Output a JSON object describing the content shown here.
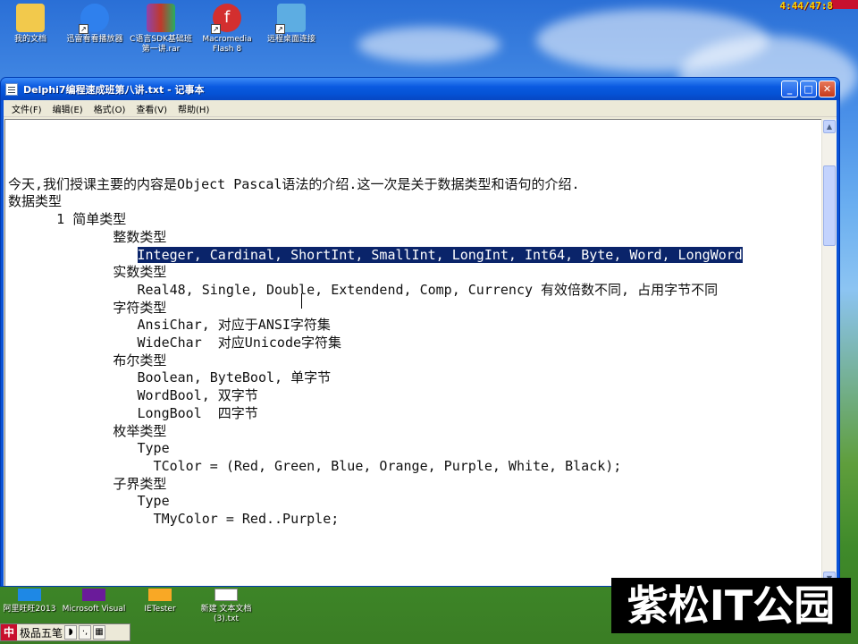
{
  "desktop": {
    "icons": [
      {
        "label": "我的文档",
        "icon": "folder-icon",
        "color": "#f2c94c"
      },
      {
        "label": "迅雷看看播放器",
        "icon": "xunlei-player-icon",
        "color": "#2f80ed"
      },
      {
        "label": "C语言SDK基础班第一讲.rar",
        "icon": "winrar-archive-icon",
        "color": "#8e44ad"
      },
      {
        "label": "Macromedia Flash 8",
        "icon": "flash-icon",
        "color": "#d32f2f"
      },
      {
        "label": "远程桌面连接",
        "icon": "remote-desktop-icon",
        "color": "#5dade2"
      }
    ],
    "bottom_icons": [
      {
        "label": "阿里旺旺2013",
        "icon": "aliwangwang-icon"
      },
      {
        "label": "Microsoft Visual",
        "icon": "visual-studio-icon"
      },
      {
        "label": "IETester",
        "icon": "ietester-icon"
      },
      {
        "label": "新建 文本文档 (3).txt",
        "icon": "text-file-icon"
      }
    ],
    "clock": "4:44/47:8"
  },
  "window": {
    "title": "Delphi7编程速成班第八讲.txt - 记事本",
    "buttons": {
      "minimize": "_",
      "maximize": "□",
      "close": "✕"
    },
    "menu": [
      "文件(F)",
      "编辑(E)",
      "格式(O)",
      "查看(V)",
      "帮助(H)"
    ]
  },
  "document": {
    "lines": [
      "今天,我们授课主要的内容是Object Pascal语法的介绍.这一次是关于数据类型和语句的介绍.",
      "数据类型",
      "      1 简单类型",
      "             整数类型",
      "",
      "",
      "             实数类型",
      "                Real48, Single, Double, Extendend, Comp, Currency 有效倍数不同, 占用字节不同",
      "",
      "             字符类型",
      "                AnsiChar, 对应于ANSI字符集",
      "                WideChar  对应Unicode字符集",
      "",
      "             布尔类型",
      "                Boolean, ByteBool, 单字节",
      "                WordBool, 双字节",
      "                LongBool  四字节",
      "",
      "             枚举类型",
      "                Type",
      "                  TColor = (Red, Green, Blue, Orange, Purple, White, Black);",
      "",
      "             子界类型",
      "                Type",
      "                  TMyColor = Red..Purple;"
    ],
    "selected_line_indent": "                ",
    "selected_text": "Integer, Cardinal, ShortInt, SmallInt, LongInt, Int64, Byte, Word, LongWord"
  },
  "ime": {
    "name": "极品五笔",
    "logo": "中"
  },
  "watermark": "紫松IT公园",
  "colors": {
    "title_bar": "#0a5ae0",
    "selection": "#0a246a",
    "client": "#ece9d8"
  }
}
